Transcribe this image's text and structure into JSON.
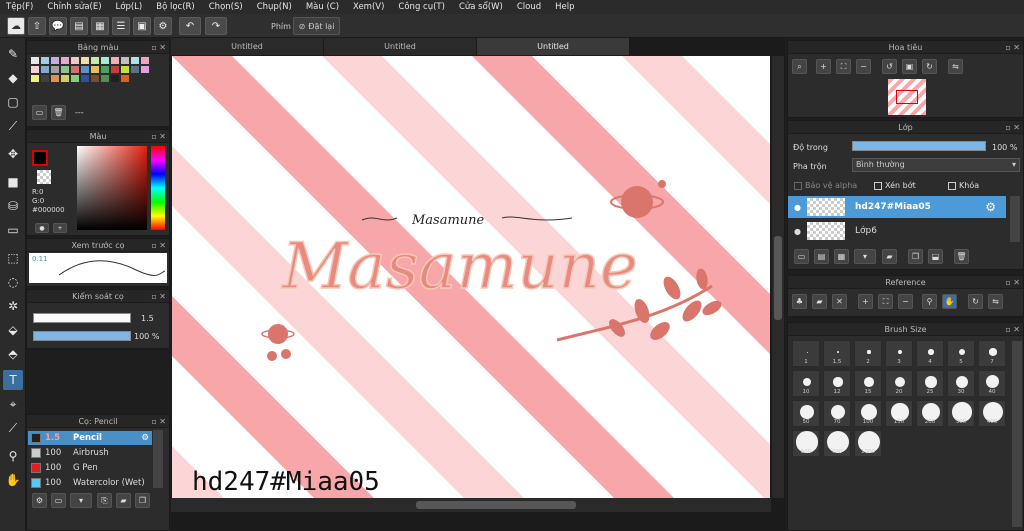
{
  "menu": [
    "Tệp(F)",
    "Chỉnh sửa(E)",
    "Lớp(L)",
    "Bộ lọc(R)",
    "Chọn(S)",
    "Chụp(N)",
    "Màu (C)",
    "Xem(V)",
    "Công cụ(T)",
    "Cửa sổ(W)",
    "Cloud",
    "Help"
  ],
  "toolbar": {
    "phim_label": "Phím",
    "reset_label": "Đặt lại"
  },
  "tabs": [
    "Untitled",
    "Untitled",
    "Untitled"
  ],
  "palette_panel": {
    "title": "Bảng màu",
    "footer_text": "---"
  },
  "color_panel": {
    "title": "Màu",
    "r": "R:0",
    "g": "G:0",
    "b": "B:0",
    "hex": "#000000",
    "primary_color": "#000000"
  },
  "brush_preview_panel": {
    "title": "Xem trước cọ",
    "size_text": "0.11"
  },
  "brush_control_panel": {
    "title": "Kiểm soát cọ",
    "size_value": "1.5",
    "opacity_value": "100 %",
    "opacity_fraction": 1.0
  },
  "brush_list_panel": {
    "title": "Cọ: Pencil",
    "brushes": [
      {
        "size": "1.5",
        "name": "Pencil",
        "color": "#222222",
        "selected": true
      },
      {
        "size": "100",
        "name": "Airbrush",
        "color": "#cccccc",
        "selected": false
      },
      {
        "size": "100",
        "name": "G Pen",
        "color": "#e02020",
        "selected": false
      },
      {
        "size": "100",
        "name": "Watercolor (Wet)",
        "color": "#5ac8f0",
        "selected": false
      }
    ]
  },
  "navigator_panel": {
    "title": "Hoa tiêu"
  },
  "layer_panel": {
    "title": "Lớp",
    "opacity_label": "Độ trong",
    "opacity_value": "100 %",
    "opacity_fraction": 1.0,
    "blend_label": "Pha trộn",
    "blend_value": "Bình thường",
    "protect_alpha": "Bảo vệ alpha",
    "clipping": "Xén bớt",
    "lock": "Khóa",
    "layers": [
      {
        "name": "hd247#Miaa05",
        "selected": true
      },
      {
        "name": "Lớp6",
        "selected": false
      }
    ]
  },
  "reference_panel": {
    "title": "Reference"
  },
  "brush_size_panel": {
    "title": "Brush Size",
    "sizes": [
      "1",
      "1.5",
      "2",
      "3",
      "4",
      "5",
      "7",
      "10",
      "12",
      "15",
      "20",
      "25",
      "30",
      "40",
      "50",
      "70",
      "100",
      "150",
      "200",
      "300",
      "400",
      "500",
      "700",
      "1000"
    ]
  },
  "artwork": {
    "title_text": "Masamune",
    "small_text": "Masamune",
    "watermark": "hd247#Miaa05",
    "stripe_color": "#f7a7a9",
    "stripe_light": "#fcd6d6",
    "lettering_color": "#e88a80",
    "accent_color": "#d9756a"
  }
}
